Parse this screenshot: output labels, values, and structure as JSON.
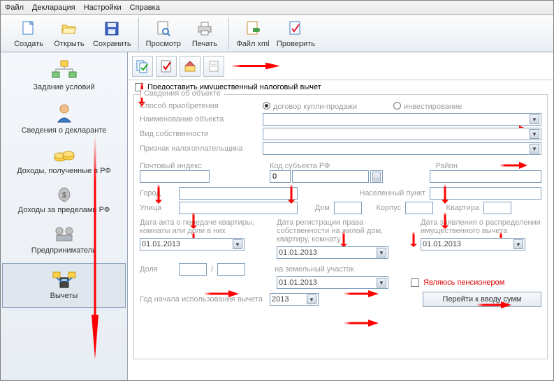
{
  "menu": {
    "file": "Файл",
    "decl": "Декларация",
    "settings": "Настройки",
    "help": "Справка"
  },
  "toolbar1": {
    "create": "Создать",
    "open": "Открыть",
    "save": "Сохранить",
    "preview": "Просмотр",
    "print": "Печать",
    "xml": "Файл xml",
    "check": "Проверить"
  },
  "nav": {
    "conditions": "Задание условий",
    "declarant": "Сведения о декларанте",
    "income_rf": "Доходы, полученные в РФ",
    "income_foreign": "Доходы за пределами РФ",
    "entrepreneur": "Предприниматели",
    "deductions": "Вычеты"
  },
  "main": {
    "grant_checkbox": "Предоставить имущественный налоговый вычет",
    "group1_legend": "Сведения об объекте",
    "acq_method": "Способ приобретения",
    "radio_contract": "договор купли-продажи",
    "radio_invest": "инвестирование",
    "object_name": "Наименование объекта",
    "ownership": "Вид собственности",
    "taxpayer_sign": "Признак налогоплательщика",
    "postal": "Почтовый индекс",
    "region_code": "Код субъекта РФ",
    "region_code_val": "0",
    "district": "Район",
    "city": "Город",
    "locality": "Населенный пункт",
    "street": "Улица",
    "house": "Дом",
    "building": "Корпус",
    "flat": "Квартира",
    "date_act": "Дата акта о передаче квартиры, комнаты или доли в них",
    "date_act_val": "01.01.2013",
    "share": "Доля",
    "year_start": "Год начала использования вычета",
    "year_start_val": "2013",
    "date_reg": "Дата регистрации права собственности на жилой дом, квартиру, комнату",
    "date_reg_val": "01.01.2013",
    "date_land": "на земельный участок",
    "date_land_val": "01.01.2013",
    "date_app": "Дата заявления о распределении имущественного вычета",
    "date_app_val": "01.01.2013",
    "pensioner": "Являюсь пенсионером",
    "goto_sums": "Перейти к вводу сумм"
  }
}
